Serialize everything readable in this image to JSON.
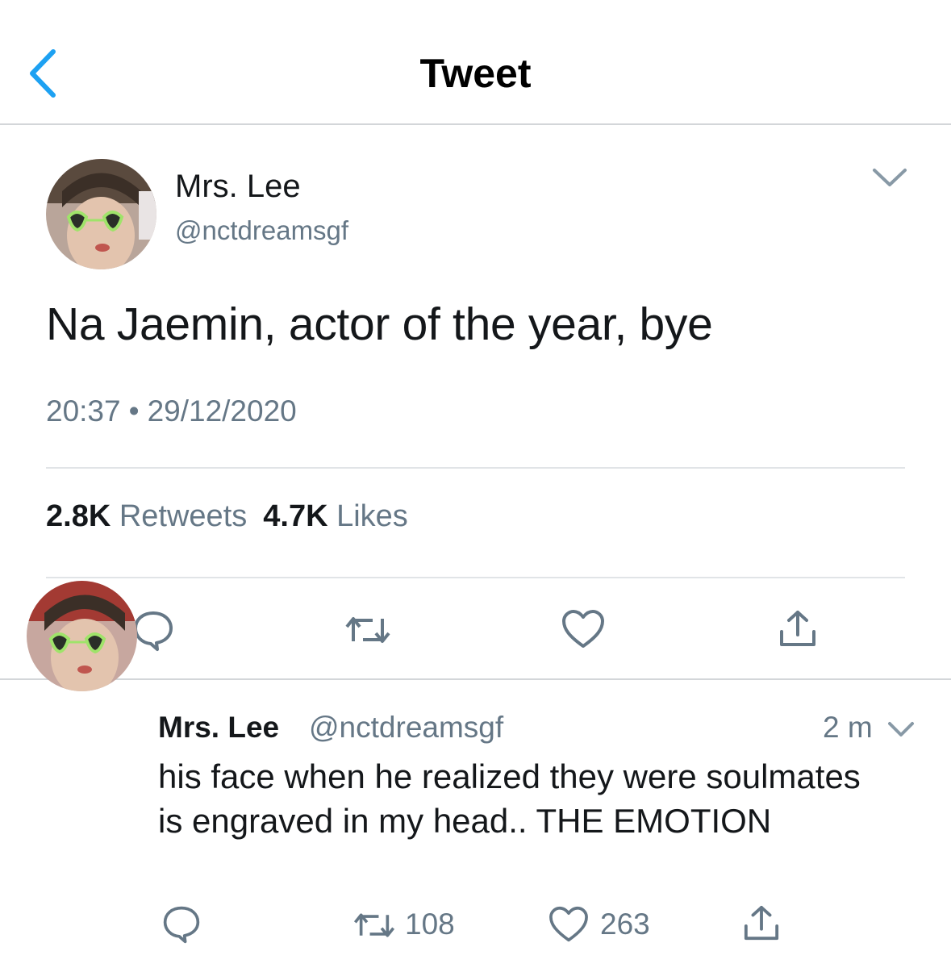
{
  "header": {
    "title": "Tweet"
  },
  "tweet": {
    "display_name": "Mrs. Lee",
    "handle": "@nctdreamsgf",
    "text": "Na Jaemin, actor of the year, bye",
    "time": "20:37",
    "separator": "•",
    "date": "29/12/2020",
    "retweets_count": "2.8K",
    "retweets_label": "Retweets",
    "likes_count": "4.7K",
    "likes_label": "Likes"
  },
  "reply": {
    "display_name": "Mrs. Lee",
    "handle": "@nctdreamsgf",
    "time_ago": "2 m",
    "text": "his face when he realized they were soulmates is engraved in my head.. THE EMOTION",
    "retweets_count": "108",
    "likes_count": "263"
  },
  "icons": {
    "back": "chevron-left-icon",
    "more": "chevron-down-icon",
    "reply": "reply-bubble-icon",
    "retweet": "retweet-icon",
    "like": "heart-icon",
    "share": "share-icon"
  },
  "colors": {
    "accent": "#1da1f2",
    "text_primary": "#14171a",
    "text_secondary": "#657786",
    "divider": "#e1e4e7",
    "icon": "#657786"
  }
}
